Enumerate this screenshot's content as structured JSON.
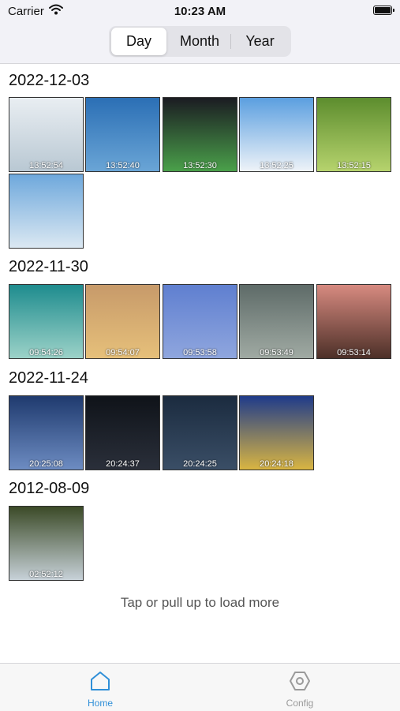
{
  "status": {
    "carrier": "Carrier",
    "time": "10:23 AM"
  },
  "segments": [
    "Day",
    "Month",
    "Year"
  ],
  "selected_segment": "Day",
  "sections": [
    {
      "date": "2022-12-03",
      "photos": [
        {
          "time": "13:52:54",
          "colors": [
            "#e9eef2",
            "#b9c8d3"
          ]
        },
        {
          "time": "13:52:40",
          "colors": [
            "#2b6fb5",
            "#6aa5d6"
          ]
        },
        {
          "time": "13:52:30",
          "colors": [
            "#1b1c22",
            "#4aa04a"
          ]
        },
        {
          "time": "13:52:25",
          "colors": [
            "#5b9fe0",
            "#eef3f8"
          ]
        },
        {
          "time": "13:52:15",
          "colors": [
            "#5d8d2e",
            "#b6d36d"
          ]
        },
        {
          "time": "",
          "colors": [
            "#6ea8dc",
            "#dbe8f2"
          ]
        }
      ]
    },
    {
      "date": "2022-11-30",
      "photos": [
        {
          "time": "09:54:26",
          "colors": [
            "#1e8c8e",
            "#9cd2c8"
          ]
        },
        {
          "time": "09:54:07",
          "colors": [
            "#c79a6a",
            "#e6c07a"
          ]
        },
        {
          "time": "09:53:58",
          "colors": [
            "#5f7fd0",
            "#8fa6de"
          ]
        },
        {
          "time": "09:53:49",
          "colors": [
            "#5e6b68",
            "#a0aaa3"
          ]
        },
        {
          "time": "09:53:14",
          "colors": [
            "#d78a80",
            "#4d3028"
          ]
        }
      ]
    },
    {
      "date": "2022-11-24",
      "photos": [
        {
          "time": "20:25:08",
          "colors": [
            "#1f3a6e",
            "#6d8cc2"
          ]
        },
        {
          "time": "20:24:37",
          "colors": [
            "#0f1319",
            "#2a2f3a"
          ]
        },
        {
          "time": "20:24:25",
          "colors": [
            "#1b2b3f",
            "#3a4e66"
          ]
        },
        {
          "time": "20:24:18",
          "colors": [
            "#1f3b8a",
            "#d9b542"
          ]
        }
      ]
    },
    {
      "date": "2012-08-09",
      "photos": [
        {
          "time": "02:52:12",
          "colors": [
            "#3b4a27",
            "#c7d1d8"
          ]
        }
      ]
    }
  ],
  "load_more": "Tap or pull up to load more",
  "tabs": [
    {
      "label": "Home",
      "icon": "home-icon",
      "active": true
    },
    {
      "label": "Config",
      "icon": "gear-hexagon-icon",
      "active": false
    }
  ],
  "colors": {
    "accent": "#2f8fd8",
    "inactive": "#9a9a9a"
  }
}
